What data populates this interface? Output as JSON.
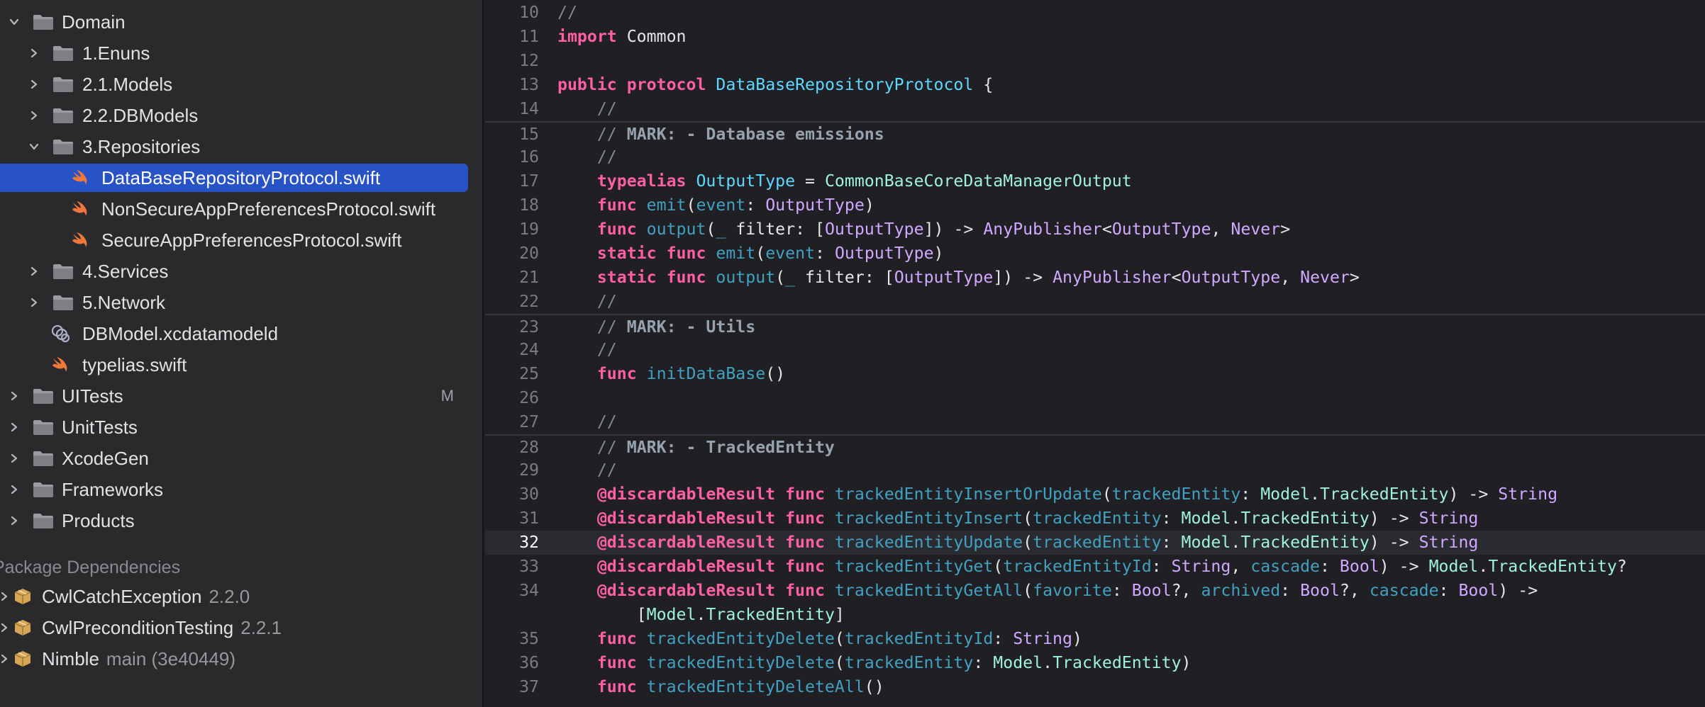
{
  "navigator": {
    "items": [
      {
        "label": "Domain",
        "icon": "folder-icon",
        "expanded": true,
        "level": 0
      },
      {
        "label": "1.Enuns",
        "icon": "folder-icon",
        "expanded": false,
        "level": 1
      },
      {
        "label": "2.1.Models",
        "icon": "folder-icon",
        "expanded": false,
        "level": 1
      },
      {
        "label": "2.2.DBModels",
        "icon": "folder-icon",
        "expanded": false,
        "level": 1
      },
      {
        "label": "3.Repositories",
        "icon": "folder-icon",
        "expanded": true,
        "level": 1
      },
      {
        "label": "DataBaseRepositoryProtocol.swift",
        "icon": "swift-file-icon",
        "selected": true,
        "level": 2
      },
      {
        "label": "NonSecureAppPreferencesProtocol.swift",
        "icon": "swift-file-icon",
        "level": 2
      },
      {
        "label": "SecureAppPreferencesProtocol.swift",
        "icon": "swift-file-icon",
        "level": 2
      },
      {
        "label": "4.Services",
        "icon": "folder-icon",
        "expanded": false,
        "level": 1
      },
      {
        "label": "5.Network",
        "icon": "folder-icon",
        "expanded": false,
        "level": 1
      },
      {
        "label": "DBModel.xcdatamodeld",
        "icon": "datamodel-icon",
        "level": 1
      },
      {
        "label": "typelias.swift",
        "icon": "swift-file-icon",
        "level": 1
      },
      {
        "label": "UITests",
        "icon": "folder-icon",
        "expanded": false,
        "level": 0,
        "badge": "M"
      },
      {
        "label": "UnitTests",
        "icon": "folder-icon",
        "expanded": false,
        "level": 0
      },
      {
        "label": "XcodeGen",
        "icon": "folder-icon",
        "expanded": false,
        "level": 0
      },
      {
        "label": "Frameworks",
        "icon": "folder-icon",
        "expanded": false,
        "level": 0
      },
      {
        "label": "Products",
        "icon": "folder-icon",
        "expanded": false,
        "level": 0
      }
    ],
    "package_section_title": "Package Dependencies",
    "packages": [
      {
        "name": "CwlCatchException",
        "version": "2.2.0",
        "icon": "package-icon"
      },
      {
        "name": "CwlPreconditionTesting",
        "version": "2.2.1",
        "icon": "package-icon"
      },
      {
        "name": "Nimble",
        "version": "main (3e40449)",
        "icon": "package-icon"
      }
    ]
  },
  "editor": {
    "current_line": "32",
    "lines": [
      {
        "n": "10",
        "tokens": [
          [
            "cm",
            "//"
          ]
        ]
      },
      {
        "n": "11",
        "tokens": [
          [
            "kw",
            "import"
          ],
          [
            "pl",
            " Common"
          ]
        ]
      },
      {
        "n": "12",
        "tokens": []
      },
      {
        "n": "13",
        "tokens": [
          [
            "kw",
            "public"
          ],
          [
            "pl",
            " "
          ],
          [
            "kw",
            "protocol"
          ],
          [
            "pl",
            " "
          ],
          [
            "ty",
            "DataBaseRepositoryProtocol"
          ],
          [
            "pl",
            " {"
          ]
        ]
      },
      {
        "n": "14",
        "tokens": [
          [
            "pl",
            "    "
          ],
          [
            "cm",
            "//"
          ]
        ]
      },
      {
        "n": "15",
        "sep": true,
        "tokens": [
          [
            "pl",
            "    "
          ],
          [
            "cm",
            "// "
          ],
          [
            "mk",
            "MARK: - Database emissions"
          ]
        ]
      },
      {
        "n": "16",
        "tokens": [
          [
            "pl",
            "    "
          ],
          [
            "cm",
            "//"
          ]
        ]
      },
      {
        "n": "17",
        "tokens": [
          [
            "pl",
            "    "
          ],
          [
            "kw",
            "typealias"
          ],
          [
            "pl",
            " "
          ],
          [
            "ty",
            "OutputType"
          ],
          [
            "pl",
            " = "
          ],
          [
            "ptl",
            "CommonBaseCoreDataManagerOutput"
          ]
        ]
      },
      {
        "n": "18",
        "tokens": [
          [
            "pl",
            "    "
          ],
          [
            "kw",
            "func"
          ],
          [
            "pl",
            " "
          ],
          [
            "fn",
            "emit"
          ],
          [
            "pl",
            "("
          ],
          [
            "fn",
            "event"
          ],
          [
            "pl",
            ": "
          ],
          [
            "tp",
            "OutputType"
          ],
          [
            "pl",
            ")"
          ]
        ]
      },
      {
        "n": "19",
        "tokens": [
          [
            "pl",
            "    "
          ],
          [
            "kw",
            "func"
          ],
          [
            "pl",
            " "
          ],
          [
            "fn",
            "output"
          ],
          [
            "pl",
            "("
          ],
          [
            "fn",
            "_"
          ],
          [
            "pl",
            " filter: ["
          ],
          [
            "tp",
            "OutputType"
          ],
          [
            "pl",
            "]) -> "
          ],
          [
            "tp",
            "AnyPublisher"
          ],
          [
            "pl",
            "<"
          ],
          [
            "tp",
            "OutputType"
          ],
          [
            "pl",
            ", "
          ],
          [
            "tp",
            "Never"
          ],
          [
            "pl",
            ">"
          ]
        ]
      },
      {
        "n": "20",
        "tokens": [
          [
            "pl",
            "    "
          ],
          [
            "kw",
            "static"
          ],
          [
            "pl",
            " "
          ],
          [
            "kw",
            "func"
          ],
          [
            "pl",
            " "
          ],
          [
            "fn",
            "emit"
          ],
          [
            "pl",
            "("
          ],
          [
            "fn",
            "event"
          ],
          [
            "pl",
            ": "
          ],
          [
            "tp",
            "OutputType"
          ],
          [
            "pl",
            ")"
          ]
        ]
      },
      {
        "n": "21",
        "tokens": [
          [
            "pl",
            "    "
          ],
          [
            "kw",
            "static"
          ],
          [
            "pl",
            " "
          ],
          [
            "kw",
            "func"
          ],
          [
            "pl",
            " "
          ],
          [
            "fn",
            "output"
          ],
          [
            "pl",
            "("
          ],
          [
            "fn",
            "_"
          ],
          [
            "pl",
            " filter: ["
          ],
          [
            "tp",
            "OutputType"
          ],
          [
            "pl",
            "]) -> "
          ],
          [
            "tp",
            "AnyPublisher"
          ],
          [
            "pl",
            "<"
          ],
          [
            "tp",
            "OutputType"
          ],
          [
            "pl",
            ", "
          ],
          [
            "tp",
            "Never"
          ],
          [
            "pl",
            ">"
          ]
        ]
      },
      {
        "n": "22",
        "tokens": [
          [
            "pl",
            "    "
          ],
          [
            "cm",
            "//"
          ]
        ]
      },
      {
        "n": "23",
        "sep": true,
        "tokens": [
          [
            "pl",
            "    "
          ],
          [
            "cm",
            "// "
          ],
          [
            "mk",
            "MARK: - Utils"
          ]
        ]
      },
      {
        "n": "24",
        "tokens": [
          [
            "pl",
            "    "
          ],
          [
            "cm",
            "//"
          ]
        ]
      },
      {
        "n": "25",
        "tokens": [
          [
            "pl",
            "    "
          ],
          [
            "kw",
            "func"
          ],
          [
            "pl",
            " "
          ],
          [
            "fn",
            "initDataBase"
          ],
          [
            "pl",
            "()"
          ]
        ]
      },
      {
        "n": "26",
        "tokens": []
      },
      {
        "n": "27",
        "tokens": [
          [
            "pl",
            "    "
          ],
          [
            "cm",
            "//"
          ]
        ]
      },
      {
        "n": "28",
        "sep": true,
        "tokens": [
          [
            "pl",
            "    "
          ],
          [
            "cm",
            "// "
          ],
          [
            "mk",
            "MARK: - TrackedEntity"
          ]
        ]
      },
      {
        "n": "29",
        "tokens": [
          [
            "pl",
            "    "
          ],
          [
            "cm",
            "//"
          ]
        ]
      },
      {
        "n": "30",
        "tokens": [
          [
            "pl",
            "    "
          ],
          [
            "kw",
            "@discardableResult"
          ],
          [
            "pl",
            " "
          ],
          [
            "kw",
            "func"
          ],
          [
            "pl",
            " "
          ],
          [
            "fn",
            "trackedEntityInsertOrUpdate"
          ],
          [
            "pl",
            "("
          ],
          [
            "fn",
            "trackedEntity"
          ],
          [
            "pl",
            ": "
          ],
          [
            "ptl",
            "Model"
          ],
          [
            "pl",
            "."
          ],
          [
            "ptl",
            "TrackedEntity"
          ],
          [
            "pl",
            ") -> "
          ],
          [
            "tp",
            "String"
          ]
        ]
      },
      {
        "n": "31",
        "tokens": [
          [
            "pl",
            "    "
          ],
          [
            "kw",
            "@discardableResult"
          ],
          [
            "pl",
            " "
          ],
          [
            "kw",
            "func"
          ],
          [
            "pl",
            " "
          ],
          [
            "fn",
            "trackedEntityInsert"
          ],
          [
            "pl",
            "("
          ],
          [
            "fn",
            "trackedEntity"
          ],
          [
            "pl",
            ": "
          ],
          [
            "ptl",
            "Model"
          ],
          [
            "pl",
            "."
          ],
          [
            "ptl",
            "TrackedEntity"
          ],
          [
            "pl",
            ") -> "
          ],
          [
            "tp",
            "String"
          ]
        ]
      },
      {
        "n": "32",
        "current": true,
        "tokens": [
          [
            "pl",
            "    "
          ],
          [
            "kw",
            "@discardableResult"
          ],
          [
            "pl",
            " "
          ],
          [
            "kw",
            "func"
          ],
          [
            "pl",
            " "
          ],
          [
            "fn",
            "trackedEntityUpdate"
          ],
          [
            "pl",
            "("
          ],
          [
            "fn",
            "trackedEntity"
          ],
          [
            "pl",
            ": "
          ],
          [
            "ptl",
            "Model"
          ],
          [
            "pl",
            "."
          ],
          [
            "ptl",
            "TrackedEntity"
          ],
          [
            "pl",
            ") -> "
          ],
          [
            "tp",
            "String"
          ]
        ]
      },
      {
        "n": "33",
        "tokens": [
          [
            "pl",
            "    "
          ],
          [
            "kw",
            "@discardableResult"
          ],
          [
            "pl",
            " "
          ],
          [
            "kw",
            "func"
          ],
          [
            "pl",
            " "
          ],
          [
            "fn",
            "trackedEntityGet"
          ],
          [
            "pl",
            "("
          ],
          [
            "fn",
            "trackedEntityId"
          ],
          [
            "pl",
            ": "
          ],
          [
            "tp",
            "String"
          ],
          [
            "pl",
            ", "
          ],
          [
            "fn",
            "cascade"
          ],
          [
            "pl",
            ": "
          ],
          [
            "tp",
            "Bool"
          ],
          [
            "pl",
            ") -> "
          ],
          [
            "ptl",
            "Model"
          ],
          [
            "pl",
            "."
          ],
          [
            "ptl",
            "TrackedEntity"
          ],
          [
            "pl",
            "?"
          ]
        ]
      },
      {
        "n": "34",
        "tokens": [
          [
            "pl",
            "    "
          ],
          [
            "kw",
            "@discardableResult"
          ],
          [
            "pl",
            " "
          ],
          [
            "kw",
            "func"
          ],
          [
            "pl",
            " "
          ],
          [
            "fn",
            "trackedEntityGetAll"
          ],
          [
            "pl",
            "("
          ],
          [
            "fn",
            "favorite"
          ],
          [
            "pl",
            ": "
          ],
          [
            "tp",
            "Bool"
          ],
          [
            "pl",
            "?, "
          ],
          [
            "fn",
            "archived"
          ],
          [
            "pl",
            ": "
          ],
          [
            "tp",
            "Bool"
          ],
          [
            "pl",
            "?, "
          ],
          [
            "fn",
            "cascade"
          ],
          [
            "pl",
            ": "
          ],
          [
            "tp",
            "Bool"
          ],
          [
            "pl",
            ") ->"
          ]
        ]
      },
      {
        "n": "",
        "continuation": true,
        "tokens": [
          [
            "pl",
            "        ["
          ],
          [
            "ptl",
            "Model"
          ],
          [
            "pl",
            "."
          ],
          [
            "ptl",
            "TrackedEntity"
          ],
          [
            "pl",
            "]"
          ]
        ]
      },
      {
        "n": "35",
        "tokens": [
          [
            "pl",
            "    "
          ],
          [
            "kw",
            "func"
          ],
          [
            "pl",
            " "
          ],
          [
            "fn",
            "trackedEntityDelete"
          ],
          [
            "pl",
            "("
          ],
          [
            "fn",
            "trackedEntityId"
          ],
          [
            "pl",
            ": "
          ],
          [
            "tp",
            "String"
          ],
          [
            "pl",
            ")"
          ]
        ]
      },
      {
        "n": "36",
        "tokens": [
          [
            "pl",
            "    "
          ],
          [
            "kw",
            "func"
          ],
          [
            "pl",
            " "
          ],
          [
            "fn",
            "trackedEntityDelete"
          ],
          [
            "pl",
            "("
          ],
          [
            "fn",
            "trackedEntity"
          ],
          [
            "pl",
            ": "
          ],
          [
            "ptl",
            "Model"
          ],
          [
            "pl",
            "."
          ],
          [
            "ptl",
            "TrackedEntity"
          ],
          [
            "pl",
            ")"
          ]
        ]
      },
      {
        "n": "37",
        "tokens": [
          [
            "pl",
            "    "
          ],
          [
            "kw",
            "func"
          ],
          [
            "pl",
            " "
          ],
          [
            "fn",
            "trackedEntityDeleteAll"
          ],
          [
            "pl",
            "()"
          ]
        ]
      }
    ]
  },
  "colors": {
    "navigator_bg": "#2a2a2d",
    "editor_bg": "#1f1f24",
    "selection": "#2853c6",
    "folder": "#9b9ba0",
    "swift": "#f0773a",
    "package": "#d8a657"
  }
}
